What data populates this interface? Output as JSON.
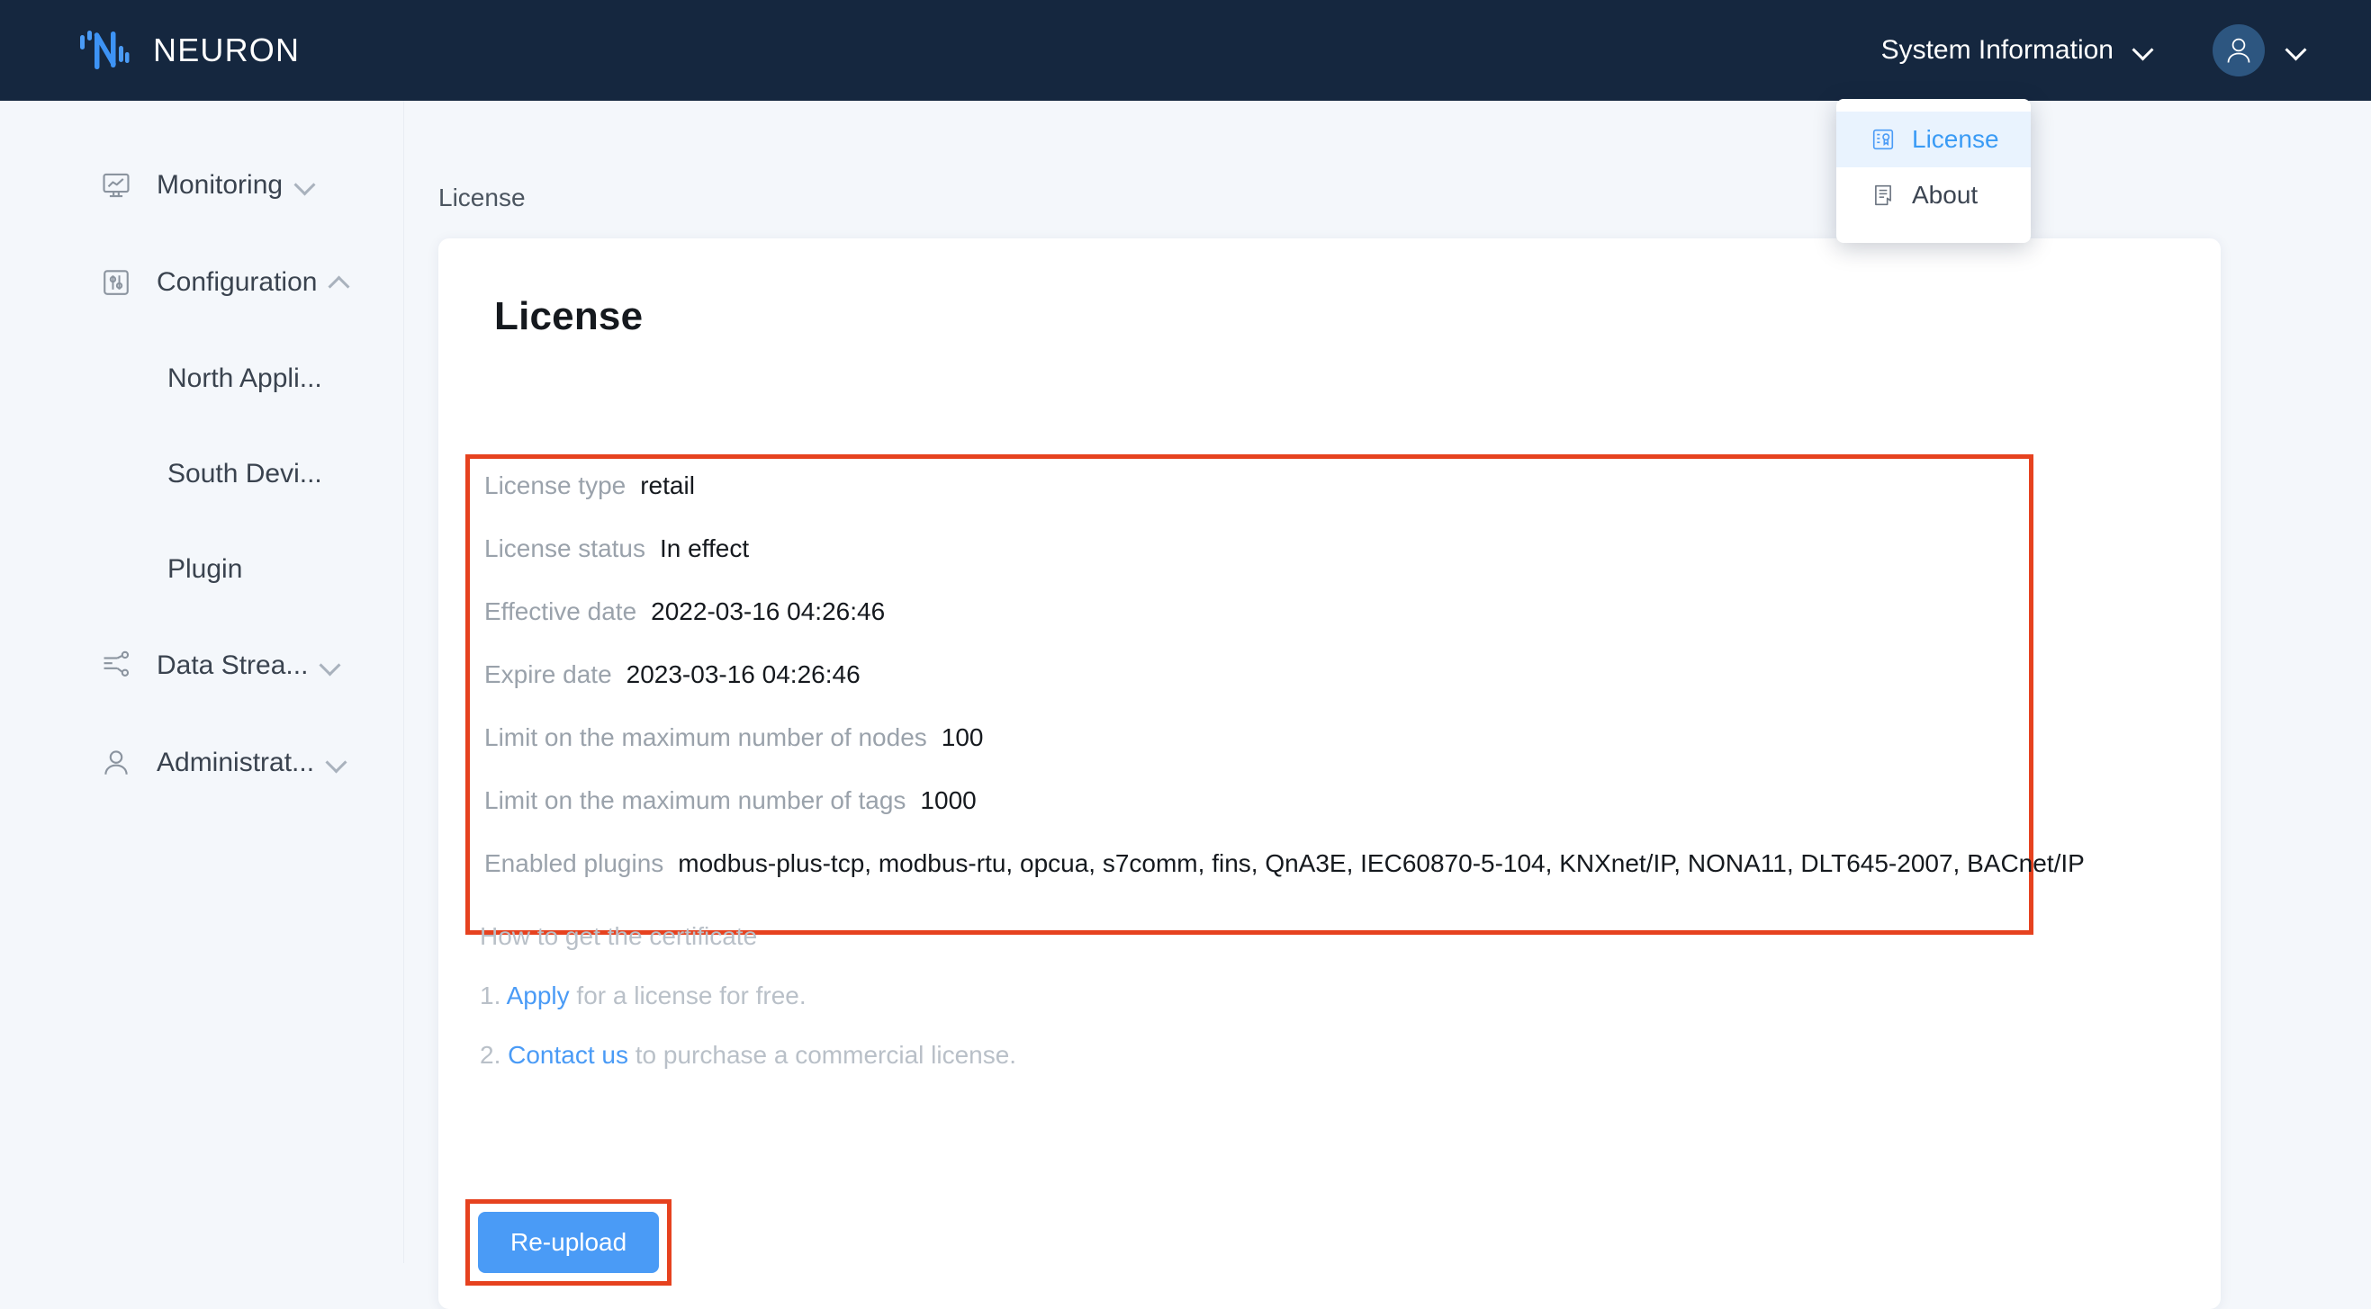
{
  "header": {
    "brand": "NEURON",
    "logo_icon": "neuron-logo-icon",
    "system_information_label": "System Information",
    "system_information_chevron": "chevron-down-icon",
    "avatar_icon": "user-avatar-icon",
    "avatar_chevron": "chevron-down-icon"
  },
  "dropdown": {
    "items": [
      {
        "label": "License",
        "icon": "certificate-icon",
        "active": true
      },
      {
        "label": "About",
        "icon": "document-icon",
        "active": false
      }
    ]
  },
  "sidebar": {
    "items": [
      {
        "label": "Monitoring",
        "icon": "monitor-chart-icon",
        "arrow": "chevron-down-icon",
        "expanded": false
      },
      {
        "label": "Configuration",
        "icon": "sliders-icon",
        "arrow": "chevron-up-icon",
        "expanded": true
      },
      {
        "label": "Data Strea...",
        "icon": "data-stream-icon",
        "arrow": "chevron-down-icon",
        "expanded": false
      },
      {
        "label": "Administrat...",
        "icon": "user-icon",
        "arrow": "chevron-down-icon",
        "expanded": false
      }
    ],
    "configuration_children": [
      {
        "label": "North Appli..."
      },
      {
        "label": "South Devi..."
      },
      {
        "label": "Plugin"
      }
    ]
  },
  "main": {
    "breadcrumb": "License",
    "card_title": "License",
    "license_info": [
      {
        "label": "License type",
        "value": "retail"
      },
      {
        "label": "License status",
        "value": "In effect"
      },
      {
        "label": "Effective date",
        "value": "2022-03-16 04:26:46"
      },
      {
        "label": "Expire date",
        "value": "2023-03-16 04:26:46"
      },
      {
        "label": "Limit on the maximum number of nodes",
        "value": "100"
      },
      {
        "label": "Limit on the maximum number of tags",
        "value": "1000"
      },
      {
        "label": "Enabled plugins",
        "value": "modbus-plus-tcp, modbus-rtu, opcua, s7comm, fins, QnA3E, IEC60870-5-104, KNXnet/IP, NONA11, DLT645-2007, BACnet/IP"
      }
    ],
    "howto": {
      "title": "How to get the certificate",
      "step1_number": "1.",
      "step1_link": "Apply",
      "step1_text": "for a license for free.",
      "step2_number": "2.",
      "step2_link": "Contact us",
      "step2_text": "to purchase a commercial license."
    },
    "reupload_button": "Re-upload"
  },
  "colors": {
    "header_bg": "#15273f",
    "page_bg": "#f4f7fb",
    "accent_blue": "#4a9bf6",
    "annotation_red": "#e6421f",
    "avatar_bg": "#2d5680",
    "logo_blue": "#4a9bf6"
  }
}
